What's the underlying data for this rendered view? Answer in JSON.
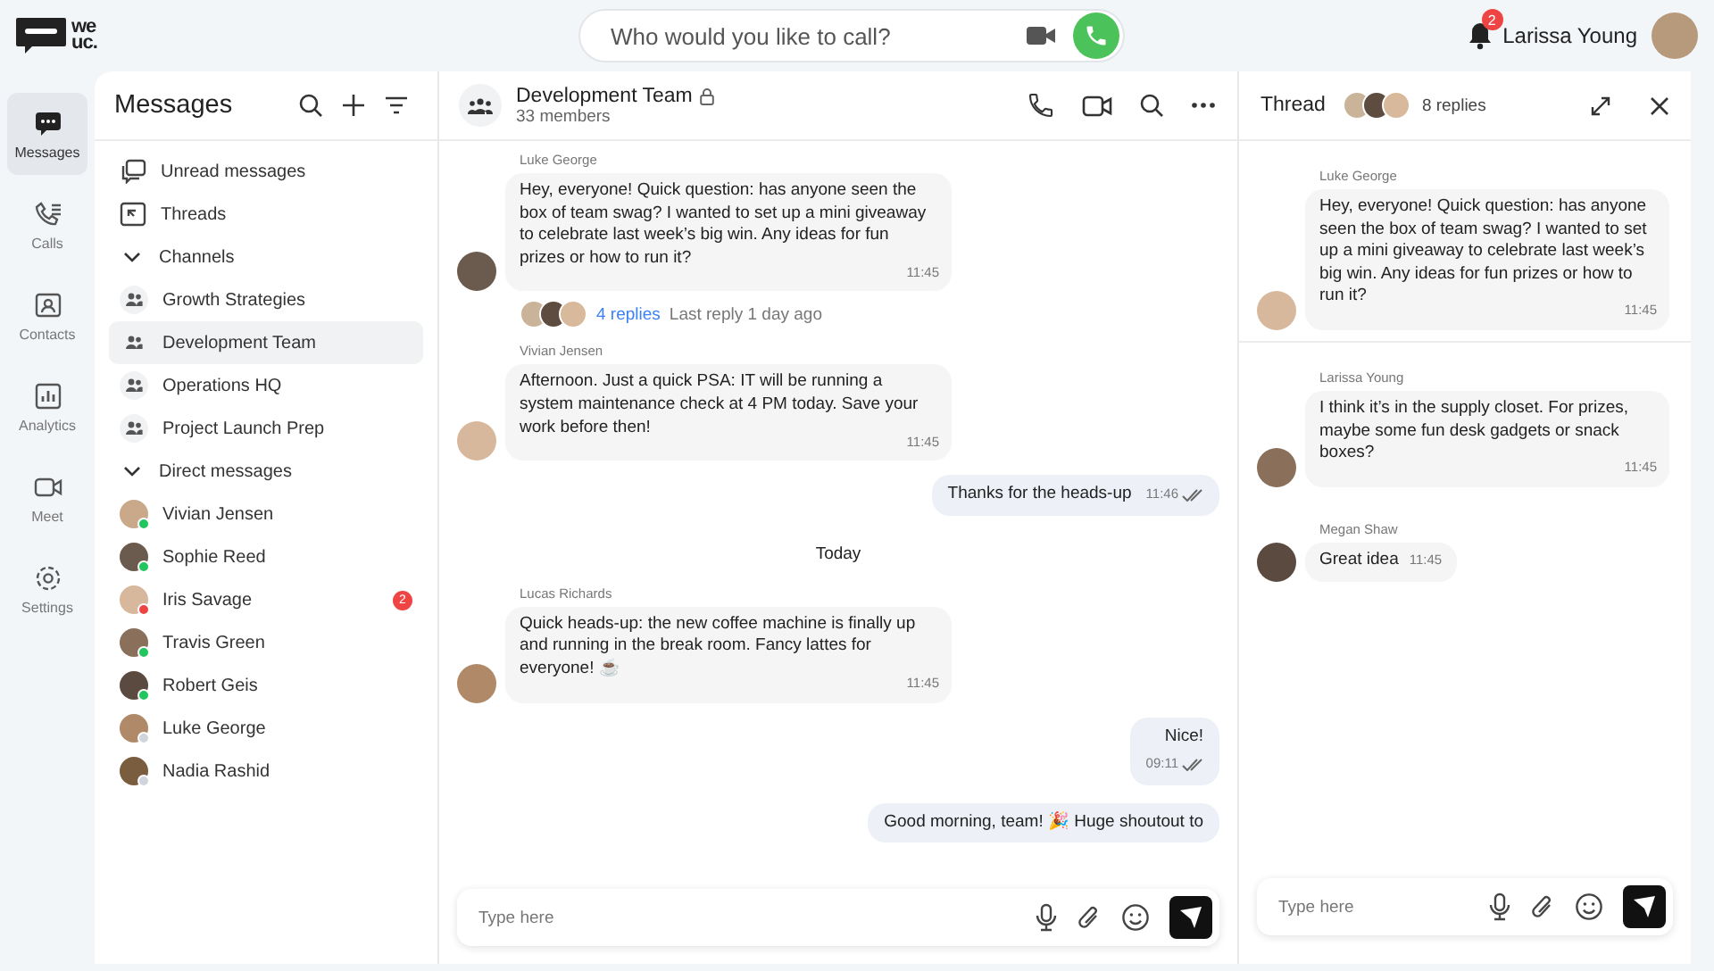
{
  "logo": {
    "line1": "we",
    "line2": "uc."
  },
  "call_search": {
    "placeholder": "Who would you like to call?"
  },
  "user": {
    "name": "Larissa Young",
    "notifications": "2"
  },
  "rail": [
    {
      "label": "Messages",
      "selected": true
    },
    {
      "label": "Calls",
      "selected": false
    },
    {
      "label": "Contacts",
      "selected": false
    },
    {
      "label": "Analytics",
      "selected": false
    },
    {
      "label": "Meet",
      "selected": false
    },
    {
      "label": "Settings",
      "selected": false
    }
  ],
  "sidebar": {
    "title": "Messages",
    "links": [
      {
        "label": "Unread messages"
      },
      {
        "label": "Threads"
      }
    ],
    "channels_label": "Channels",
    "channels": [
      {
        "name": "Growth Strategies",
        "selected": false
      },
      {
        "name": "Development Team",
        "selected": true
      },
      {
        "name": "Operations HQ",
        "selected": false
      },
      {
        "name": "Project Launch Prep",
        "selected": false
      }
    ],
    "dm_label": "Direct messages",
    "direct_messages": [
      {
        "name": "Vivian Jensen",
        "color": "#22c55e"
      },
      {
        "name": "Sophie Reed",
        "color": "#22c55e"
      },
      {
        "name": "Iris Savage",
        "color": "#ef4444",
        "unread": "2"
      },
      {
        "name": "Travis Green",
        "color": "#22c55e"
      },
      {
        "name": "Robert Geis",
        "color": "#22c55e"
      },
      {
        "name": "Luke George",
        "color": "#d1d5db"
      },
      {
        "name": "Nadia Rashid",
        "color": "#d1d5db"
      }
    ]
  },
  "chat": {
    "title": "Development Team",
    "members": "33 members",
    "messages": [
      {
        "kind": "incoming",
        "author": "Luke George",
        "text": "Hey, everyone! Quick question: has anyone seen the box of team swag? I wanted to set up a mini giveaway to celebrate last week’s big win. Any ideas for fun prizes or how to run it?",
        "time": "11:45",
        "replies": "4 replies",
        "last_reply": "Last reply 1 day ago"
      },
      {
        "kind": "incoming",
        "author": "Vivian Jensen",
        "text": "Afternoon. Just a quick PSA: IT will be running a system maintenance check at 4 PM today. Save your work before then!",
        "time": "11:45"
      },
      {
        "kind": "outgoing",
        "text": "Thanks for the heads-up",
        "time": "11:46"
      },
      {
        "kind": "date",
        "text": "Today"
      },
      {
        "kind": "incoming",
        "author": "Lucas Richards",
        "text": "Quick heads-up: the new coffee machine is finally up and running in the break room. Fancy lattes for everyone! ☕",
        "time": "11:45"
      },
      {
        "kind": "outgoing",
        "text": "Nice!",
        "time": "09:11"
      },
      {
        "kind": "outgoing",
        "text": "Good morning, team! 🎉 Huge shoutout to"
      }
    ],
    "composer": {
      "placeholder": "Type here"
    }
  },
  "thread": {
    "title": "Thread",
    "replies": "8 replies",
    "messages": [
      {
        "author": "Luke George",
        "text": "Hey, everyone! Quick question: has anyone seen the box of team swag? I wanted to set up a mini giveaway to celebrate last week’s big win. Any ideas for fun prizes or how to run it?",
        "time": "11:45"
      },
      {
        "author": "Larissa Young",
        "text": "I think it’s in the supply closet. For prizes, maybe some fun desk gadgets or snack boxes?",
        "time": "11:45"
      },
      {
        "author": "Megan Shaw",
        "text": "Great idea",
        "time": "11:45"
      }
    ],
    "composer": {
      "placeholder": "Type here"
    }
  }
}
